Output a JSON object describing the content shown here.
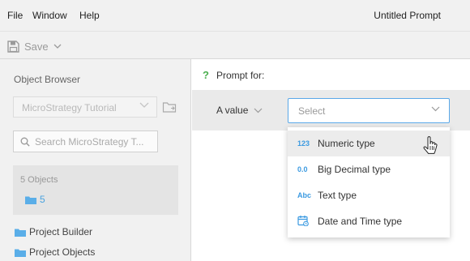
{
  "menu": {
    "file": "File",
    "window": "Window",
    "help": "Help"
  },
  "window_title": "Untitled Prompt",
  "toolbar": {
    "save_label": "Save"
  },
  "object_browser": {
    "title": "Object Browser",
    "project_select": "MicroStrategy Tutorial",
    "search_placeholder": "Search MicroStrategy T...",
    "objects_count": "5 Objects",
    "folder_item": "5",
    "tree": [
      "Project Builder",
      "Project Objects"
    ]
  },
  "prompt": {
    "prompt_for": "Prompt for:",
    "value_label": "A value",
    "select_placeholder": "Select"
  },
  "dropdown": {
    "items": [
      {
        "icon": "123",
        "label": "Numeric type"
      },
      {
        "icon": "0.0",
        "label": "Big Decimal type"
      },
      {
        "icon": "Abc",
        "label": "Text type"
      },
      {
        "icon": "calendar-icon",
        "label": "Date and Time type"
      }
    ]
  },
  "colors": {
    "accent": "#3b9ae1",
    "help_green": "#4caf50",
    "folder": "#5aaee8"
  }
}
